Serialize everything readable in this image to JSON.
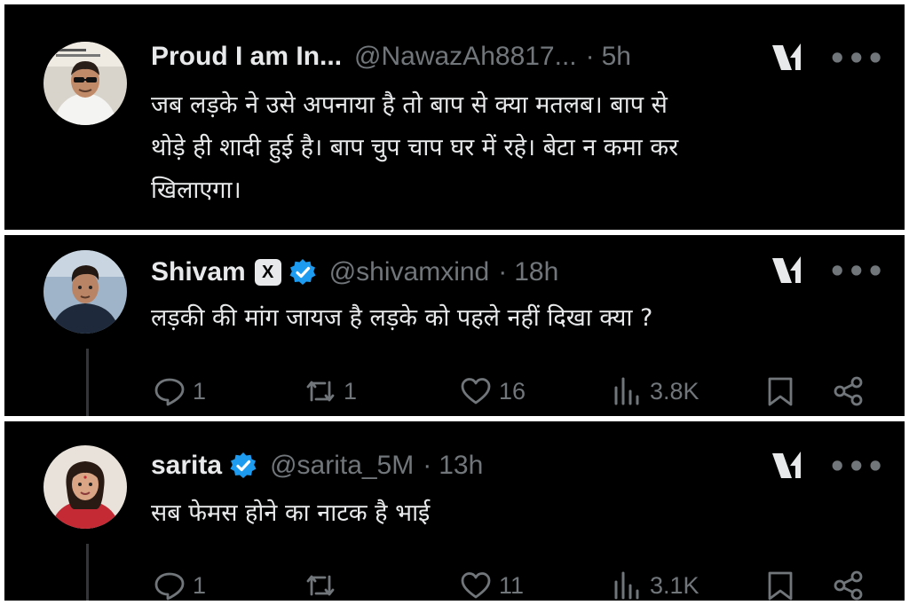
{
  "tweets": [
    {
      "name": "Proud I am In...",
      "handle": "@NawazAh8817...",
      "dot": "·",
      "time": "5h",
      "more": "•••",
      "lines": [
        "जब लड़के ने उसे अपनाया है तो बाप से क्या मतलब। बाप से",
        "थोड़े ही शादी हुई है। बाप चुप चाप घर में रहे। बेटा न कमा कर",
        "खिलाएगा।"
      ]
    },
    {
      "name": "Shivam",
      "badge": "X",
      "handle": "@shivamxind",
      "dot": "·",
      "time": "18h",
      "more": "•••",
      "lines": [
        "लड़की की मांग जायज है लड़के को पहले नहीं दिखा क्या ?"
      ],
      "stats": {
        "replies": "1",
        "reposts": "1",
        "likes": "16",
        "views": "3.8K"
      }
    },
    {
      "name": "sarita",
      "handle": "@sarita_5M",
      "dot": "·",
      "time": "13h",
      "more": "•••",
      "lines": [
        "सब फेमस होने का नाटक है भाई"
      ],
      "stats": {
        "replies": "1",
        "reposts": "",
        "likes": "11",
        "views": "3.1K"
      }
    }
  ],
  "icons": {
    "grok": "grok-icon",
    "verified": "verified-badge-icon",
    "reply": "reply-icon",
    "repost": "repost-icon",
    "like": "heart-icon",
    "views": "views-icon",
    "bookmark": "bookmark-icon",
    "share": "share-icon"
  },
  "colors": {
    "background": "#000000",
    "text": "#e7e9ea",
    "secondary": "#71767b",
    "verified": "#1d9bf0"
  }
}
